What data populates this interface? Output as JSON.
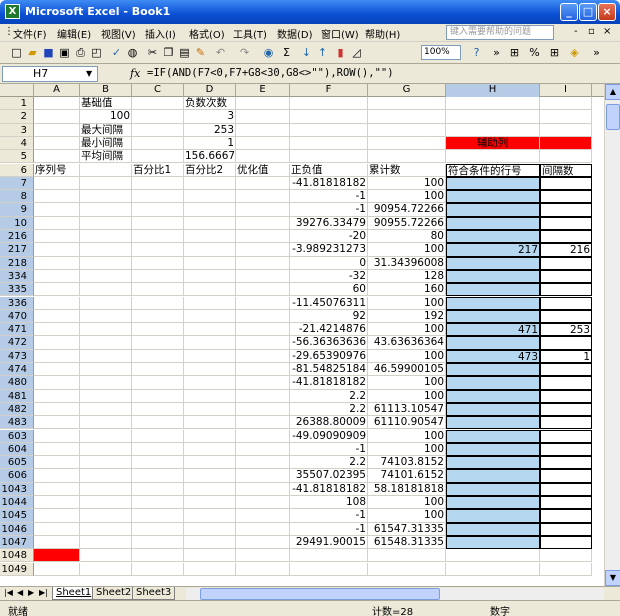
{
  "window": {
    "title": "Microsoft Excel - Book1",
    "app_icon": "X"
  },
  "menu": [
    "文件(F)",
    "编辑(E)",
    "视图(V)",
    "插入(I)",
    "格式(O)",
    "工具(T)",
    "数据(D)",
    "窗口(W)",
    "帮助(H)"
  ],
  "help_placeholder": "键入需要帮助的问题",
  "toolbar": {
    "zoom": "100%"
  },
  "formula_bar": {
    "name_box": "H7",
    "fx": "fx",
    "formula": "=IF(AND(F7<0,F7+G8<30,G8<>\"\"),ROW(),\"\")"
  },
  "columns": [
    "A",
    "B",
    "C",
    "D",
    "E",
    "F",
    "G",
    "H",
    "I"
  ],
  "selected_column": "H",
  "rows": [
    {
      "n": "1",
      "B": "基础值",
      "D": "负数次数"
    },
    {
      "n": "2",
      "B": "100",
      "D": "3"
    },
    {
      "n": "3",
      "B": "最大间隔",
      "D": "253"
    },
    {
      "n": "4",
      "B": "最小间隔",
      "D": "1",
      "H": "辅助列"
    },
    {
      "n": "5",
      "B": "平均间隔",
      "D": "156.6667"
    },
    {
      "n": "6",
      "A": "序列号",
      "C": "百分比1",
      "D": "百分比2",
      "E": "优化值",
      "F": "正负值",
      "G": "累计数",
      "H": "符合条件的行号",
      "I": "间隔数"
    },
    {
      "n": "7",
      "F": "-41.81818182",
      "G": "100"
    },
    {
      "n": "8",
      "F": "-1",
      "G": "100"
    },
    {
      "n": "9",
      "F": "-1",
      "G": "90954.72266"
    },
    {
      "n": "10",
      "F": "39276.33479",
      "G": "90955.72266"
    },
    {
      "n": "216",
      "F": "-20",
      "G": "80"
    },
    {
      "n": "217",
      "F": "-3.989231273",
      "G": "100",
      "H": "217",
      "I": "216"
    },
    {
      "n": "218",
      "F": "0",
      "G": "31.34396008"
    },
    {
      "n": "334",
      "F": "-32",
      "G": "128"
    },
    {
      "n": "335",
      "F": "60",
      "G": "160"
    },
    {
      "n": "336",
      "F": "-11.45076311",
      "G": "100"
    },
    {
      "n": "470",
      "F": "92",
      "G": "192"
    },
    {
      "n": "471",
      "F": "-21.4214876",
      "G": "100",
      "H": "471",
      "I": "253"
    },
    {
      "n": "472",
      "F": "-56.36363636",
      "G": "43.63636364"
    },
    {
      "n": "473",
      "F": "-29.65390976",
      "G": "100",
      "H": "473",
      "I": "1"
    },
    {
      "n": "474",
      "F": "-81.54825184",
      "G": "46.59900105"
    },
    {
      "n": "480",
      "F": "-41.81818182",
      "G": "100"
    },
    {
      "n": "481",
      "F": "2.2",
      "G": "100"
    },
    {
      "n": "482",
      "F": "2.2",
      "G": "61113.10547"
    },
    {
      "n": "483",
      "F": "26388.80009",
      "G": "61110.90547"
    },
    {
      "n": "603",
      "F": "-49.09090909",
      "G": "100"
    },
    {
      "n": "604",
      "F": "-1",
      "G": "100"
    },
    {
      "n": "605",
      "F": "2.2",
      "G": "74103.8152"
    },
    {
      "n": "606",
      "F": "35507.02395",
      "G": "74101.6152"
    },
    {
      "n": "1043",
      "F": "-41.81818182",
      "G": "58.18181818"
    },
    {
      "n": "1044",
      "F": "108",
      "G": "100"
    },
    {
      "n": "1045",
      "F": "-1",
      "G": "100"
    },
    {
      "n": "1046",
      "F": "-1",
      "G": "61547.31335"
    },
    {
      "n": "1047",
      "F": "29491.90015",
      "G": "61548.31335"
    },
    {
      "n": "1048"
    },
    {
      "n": "1049"
    }
  ],
  "sheets": [
    "Sheet1",
    "Sheet2",
    "Sheet3"
  ],
  "active_sheet": "Sheet1",
  "status": {
    "ready": "就绪",
    "count": "计数=28",
    "num": "数字"
  },
  "colors": {
    "highlight": "#b6d7f0",
    "red": "#ff0000",
    "title": "#0a4fd4"
  }
}
